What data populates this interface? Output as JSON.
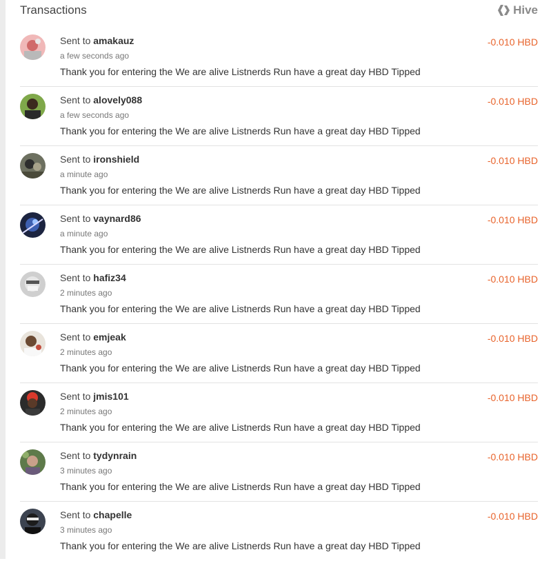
{
  "header": {
    "title": "Transactions",
    "brand": "Hive"
  },
  "colors": {
    "amount": "#e8632b",
    "brand": "#8a8a8a"
  },
  "transactions": [
    {
      "prefix": "Sent to",
      "user": "amakauz",
      "time": "a few seconds ago",
      "memo": "Thank you for entering the We are alive Listnerds Run have a great day HBD Tipped",
      "amount": "-0.010 HBD"
    },
    {
      "prefix": "Sent to",
      "user": "alovely088",
      "time": "a few seconds ago",
      "memo": "Thank you for entering the We are alive Listnerds Run have a great day HBD Tipped",
      "amount": "-0.010 HBD"
    },
    {
      "prefix": "Sent to",
      "user": "ironshield",
      "time": "a minute ago",
      "memo": "Thank you for entering the We are alive Listnerds Run have a great day HBD Tipped",
      "amount": "-0.010 HBD"
    },
    {
      "prefix": "Sent to",
      "user": "vaynard86",
      "time": "a minute ago",
      "memo": "Thank you for entering the We are alive Listnerds Run have a great day HBD Tipped",
      "amount": "-0.010 HBD"
    },
    {
      "prefix": "Sent to",
      "user": "hafiz34",
      "time": "2 minutes ago",
      "memo": "Thank you for entering the We are alive Listnerds Run have a great day HBD Tipped",
      "amount": "-0.010 HBD"
    },
    {
      "prefix": "Sent to",
      "user": "emjeak",
      "time": "2 minutes ago",
      "memo": "Thank you for entering the We are alive Listnerds Run have a great day HBD Tipped",
      "amount": "-0.010 HBD"
    },
    {
      "prefix": "Sent to",
      "user": "jmis101",
      "time": "2 minutes ago",
      "memo": "Thank you for entering the We are alive Listnerds Run have a great day HBD Tipped",
      "amount": "-0.010 HBD"
    },
    {
      "prefix": "Sent to",
      "user": "tydynrain",
      "time": "3 minutes ago",
      "memo": "Thank you for entering the We are alive Listnerds Run have a great day HBD Tipped",
      "amount": "-0.010 HBD"
    },
    {
      "prefix": "Sent to",
      "user": "chapelle",
      "time": "3 minutes ago",
      "memo": "Thank you for entering the We are alive Listnerds Run have a great day HBD Tipped",
      "amount": "-0.010 HBD"
    }
  ]
}
